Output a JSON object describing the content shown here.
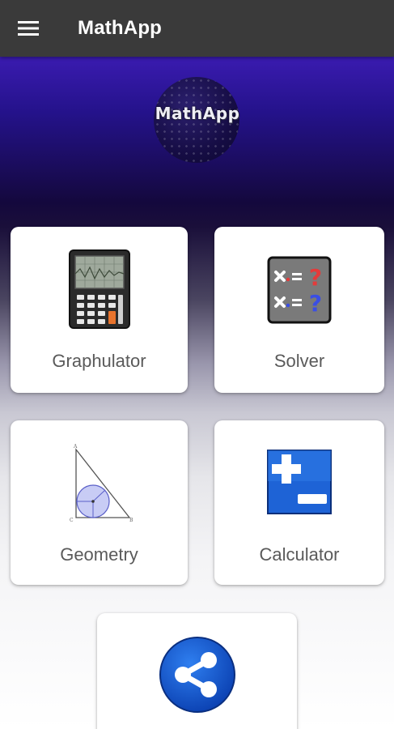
{
  "appbar": {
    "title": "MathApp",
    "menu_icon": "hamburger-menu-icon",
    "background": "#3a3a3a"
  },
  "hero": {
    "logo_text": "MathApp",
    "colors": {
      "top": "#3a1bb0",
      "dark": "#14083d",
      "bottom": "#ffffff"
    }
  },
  "cards": [
    {
      "label": "Graphulator",
      "icon": "graphing-calculator-icon"
    },
    {
      "label": "Solver",
      "icon": "equation-solver-icon"
    },
    {
      "label": "Geometry",
      "icon": "triangle-incircle-icon"
    },
    {
      "label": "Calculator",
      "icon": "plus-minus-calculator-icon"
    },
    {
      "label": "",
      "icon": "share-icon"
    }
  ]
}
